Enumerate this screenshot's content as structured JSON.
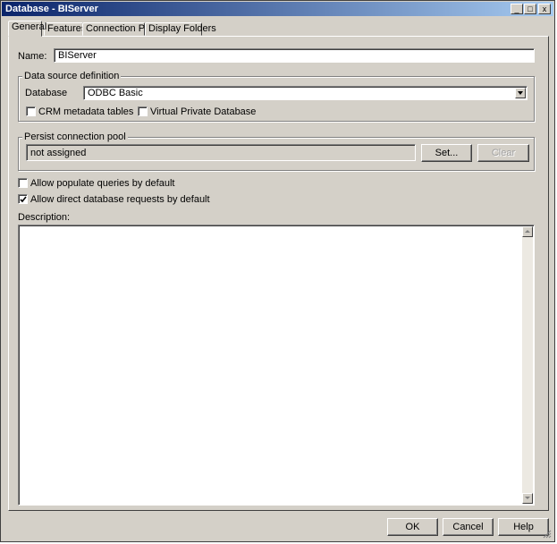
{
  "window": {
    "title": "Database - BIServer",
    "minimize_glyph": "_",
    "maximize_glyph": "□",
    "close_glyph": "x"
  },
  "tabs": [
    {
      "label": "General",
      "active": true
    },
    {
      "label": "Features",
      "active": false
    },
    {
      "label": "Connection Pools",
      "active": false
    },
    {
      "label": "Display Folders",
      "active": false
    }
  ],
  "general": {
    "name_label": "Name:",
    "name_value": "BIServer",
    "data_source": {
      "legend": "Data source definition",
      "database_label": "Database",
      "database_value": "ODBC Basic",
      "crm_label": "CRM metadata tables",
      "crm_checked": false,
      "vpd_label": "Virtual Private Database",
      "vpd_checked": false
    },
    "persist": {
      "legend": "Persist connection pool",
      "value": "not assigned",
      "set_label": "Set...",
      "clear_label": "Clear"
    },
    "allow_populate_label": "Allow populate queries by default",
    "allow_populate_checked": false,
    "allow_direct_label": "Allow direct database requests by default",
    "allow_direct_checked": true,
    "description_label": "Description:",
    "description_value": ""
  },
  "buttons": {
    "ok": "OK",
    "cancel": "Cancel",
    "help": "Help"
  },
  "icons": {
    "dropdown": "chevron-down-icon",
    "scroll_up": "scroll-up-arrow-icon",
    "scroll_down": "scroll-down-arrow-icon",
    "checkmark": "checkmark-icon",
    "resize": "resize-grip-icon"
  },
  "colors": {
    "face": "#d4d0c8",
    "titlebar_start": "#0a246a",
    "titlebar_end": "#a6caf0"
  }
}
